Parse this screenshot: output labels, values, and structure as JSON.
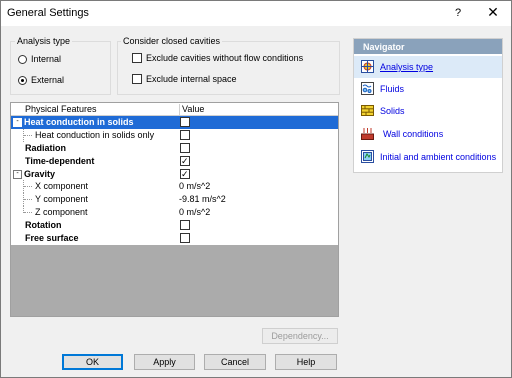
{
  "window": {
    "title": "General Settings",
    "help_glyph": "?",
    "close_glyph": "✕"
  },
  "analysis_type": {
    "label": "Analysis type",
    "options": [
      {
        "label": "Internal",
        "selected": false
      },
      {
        "label": "External",
        "selected": true
      }
    ]
  },
  "closed_cavities": {
    "label": "Consider closed cavities",
    "options": [
      {
        "label": "Exclude cavities without flow conditions",
        "checked": false
      },
      {
        "label": "Exclude internal space",
        "checked": false
      }
    ]
  },
  "grid": {
    "header_feature": "Physical Features",
    "header_value": "Value",
    "rows": [
      {
        "label": "Heat conduction in solids",
        "bold": true,
        "expander": "-",
        "checked": true,
        "selected": true
      },
      {
        "label": "Heat conduction in solids only",
        "bold": false,
        "checked": false
      },
      {
        "label": "Radiation",
        "bold": true,
        "checked": false
      },
      {
        "label": "Time-dependent",
        "bold": true,
        "checked": true
      },
      {
        "label": "Gravity",
        "bold": true,
        "expander": "-",
        "checked": true
      },
      {
        "label": "X component",
        "bold": false,
        "value": "0 m/s^2"
      },
      {
        "label": "Y component",
        "bold": false,
        "value": "-9.81 m/s^2"
      },
      {
        "label": "Z component",
        "bold": false,
        "value": "0 m/s^2"
      },
      {
        "label": "Rotation",
        "bold": true,
        "checked": false
      },
      {
        "label": "Free surface",
        "bold": true,
        "checked": false
      }
    ]
  },
  "buttons": {
    "dependency": "Dependency...",
    "ok": "OK",
    "apply": "Apply",
    "cancel": "Cancel",
    "help": "Help"
  },
  "navigator": {
    "title": "Navigator",
    "items": [
      {
        "label": "Analysis type",
        "icon": "analysis-type-icon",
        "active": true
      },
      {
        "label": "Fluids",
        "icon": "fluids-icon",
        "active": false
      },
      {
        "label": "Solids",
        "icon": "solids-icon",
        "active": false
      },
      {
        "label": "Wall conditions",
        "icon": "wall-conditions-icon",
        "active": false
      },
      {
        "label": "Initial and ambient conditions",
        "icon": "initial-conditions-icon",
        "active": false
      }
    ]
  },
  "colors": {
    "selection": "#1f6bd6",
    "navigator_header": "#8aa2bb",
    "link": "#0000e0"
  }
}
